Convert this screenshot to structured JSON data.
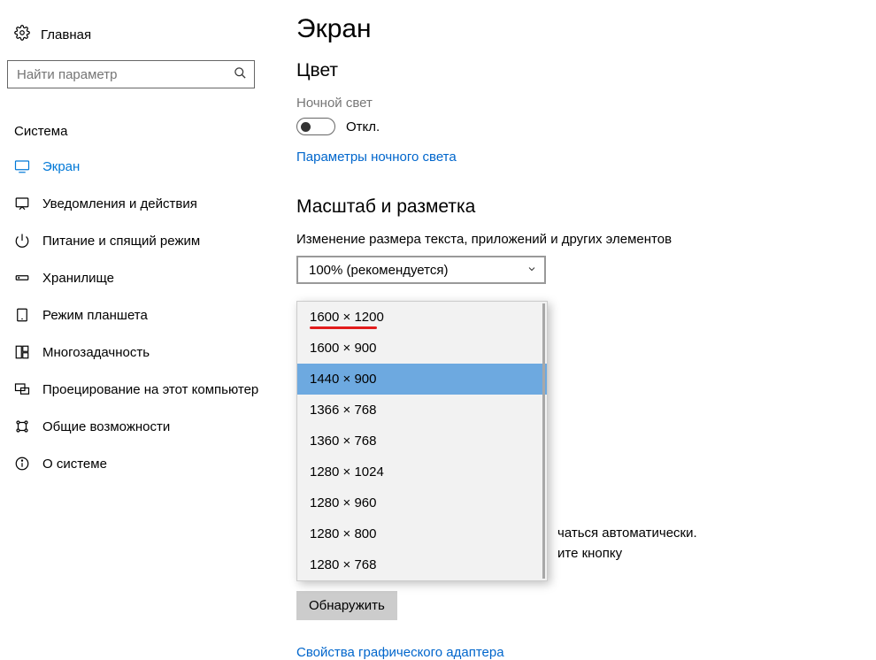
{
  "sidebar": {
    "home_label": "Главная",
    "search_placeholder": "Найти параметр",
    "category_label": "Система",
    "items": [
      {
        "label": "Экран",
        "icon": "display"
      },
      {
        "label": "Уведомления и действия",
        "icon": "notifications"
      },
      {
        "label": "Питание и спящий режим",
        "icon": "power"
      },
      {
        "label": "Хранилище",
        "icon": "storage"
      },
      {
        "label": "Режим планшета",
        "icon": "tablet"
      },
      {
        "label": "Многозадачность",
        "icon": "multitask"
      },
      {
        "label": "Проецирование на этот компьютер",
        "icon": "project"
      },
      {
        "label": "Общие возможности",
        "icon": "shared"
      },
      {
        "label": "О системе",
        "icon": "about"
      }
    ]
  },
  "main": {
    "page_title": "Экран",
    "color_section": "Цвет",
    "night_light_label": "Ночной свет",
    "night_light_state": "Откл.",
    "night_light_settings_link": "Параметры ночного света",
    "scale_section": "Масштаб и разметка",
    "scale_field_label": "Изменение размера текста, приложений и других элементов",
    "scale_selected": "100% (рекомендуется)",
    "resolution_options": [
      "1600 × 1200",
      "1600 × 900",
      "1440 × 900",
      "1366 × 768",
      "1360 × 768",
      "1280 × 1024",
      "1280 × 960",
      "1280 × 800",
      "1280 × 768"
    ],
    "resolution_selected_index": 2,
    "resolution_highlight_index": 0,
    "overflow_text_line1": "чаться автоматически.",
    "overflow_text_line2": "ите кнопку",
    "overflow_cut_word": "Обнаружить .",
    "detect_button": "Обнаружить",
    "adapter_link": "Свойства графического адаптера"
  }
}
